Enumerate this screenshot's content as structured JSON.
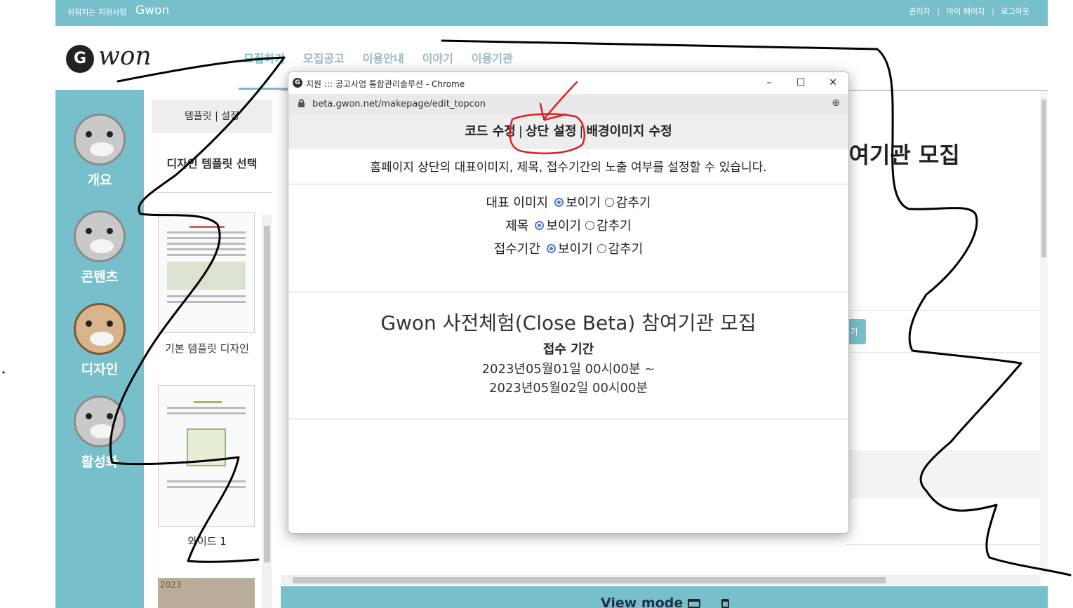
{
  "topbar": {
    "tagline": "쉬워지는 지원사업",
    "brand": "Gwon",
    "links": [
      "관리자",
      "마이 페이지",
      "로그아웃"
    ],
    "separator": "|"
  },
  "logo": {
    "glyph": "G",
    "wordmark": "won"
  },
  "nav": {
    "items": [
      "모집하기",
      "모집공고",
      "이용안내",
      "이야기",
      "이용기관"
    ],
    "active_index": 0
  },
  "sidebar": {
    "items": [
      {
        "label": "개요",
        "icon": "otter-icon"
      },
      {
        "label": "콘텐츠",
        "icon": "otter-clipboard-icon"
      },
      {
        "label": "디자인",
        "icon": "otter-artist-icon"
      },
      {
        "label": "활성화",
        "icon": "otter-icon"
      }
    ]
  },
  "template_panel": {
    "tabs": "템플릿 | 설정",
    "title": "디자인 템플릿 선택",
    "templates": [
      {
        "label": "기본 템플릿 디자인"
      },
      {
        "label": "와이드 1"
      }
    ],
    "partial_thumb_text": "2023"
  },
  "main": {
    "title_fragment": "참여기관 모집",
    "button_fragment": "기",
    "view_mode_label": "View mode",
    "view_icons": [
      "desktop-icon",
      "mobile-icon"
    ]
  },
  "popup": {
    "window_title": "지원 ::: 공고사업 통합관리솔루션 - Chrome",
    "url": "beta.gwon.net/makepage/edit_topcon",
    "controls": {
      "minimize": "–",
      "maximize": "☐",
      "close": "✕"
    },
    "tabs": [
      "코드 수정",
      "상단 설정",
      "배경이미지 수정"
    ],
    "tab_separator": "|",
    "active_tab": 1,
    "description": "홈페이지 상단의 대표이미지, 제목, 접수기간의 노출 여부를 설정할 수 있습니다.",
    "options": [
      {
        "label": "대표 이미지",
        "show": "보이기",
        "hide": "감추기",
        "selected": "show"
      },
      {
        "label": "제목",
        "show": "보이기",
        "hide": "감추기",
        "selected": "show"
      },
      {
        "label": "접수기간",
        "show": "보이기",
        "hide": "감추기",
        "selected": "show"
      }
    ],
    "preview": {
      "title": "Gwon 사전체험(Close Beta) 참여기관 모집",
      "period_label": "접수 기간",
      "start": "2023년05월01일 00시00분 ~",
      "end": "2023년05월02일 00시00분"
    }
  },
  "colors": {
    "brand": "#78bfcc",
    "radio_selected": "#4b7bd9",
    "annotation_red": "#e02020",
    "annotation_black": "#000000"
  }
}
